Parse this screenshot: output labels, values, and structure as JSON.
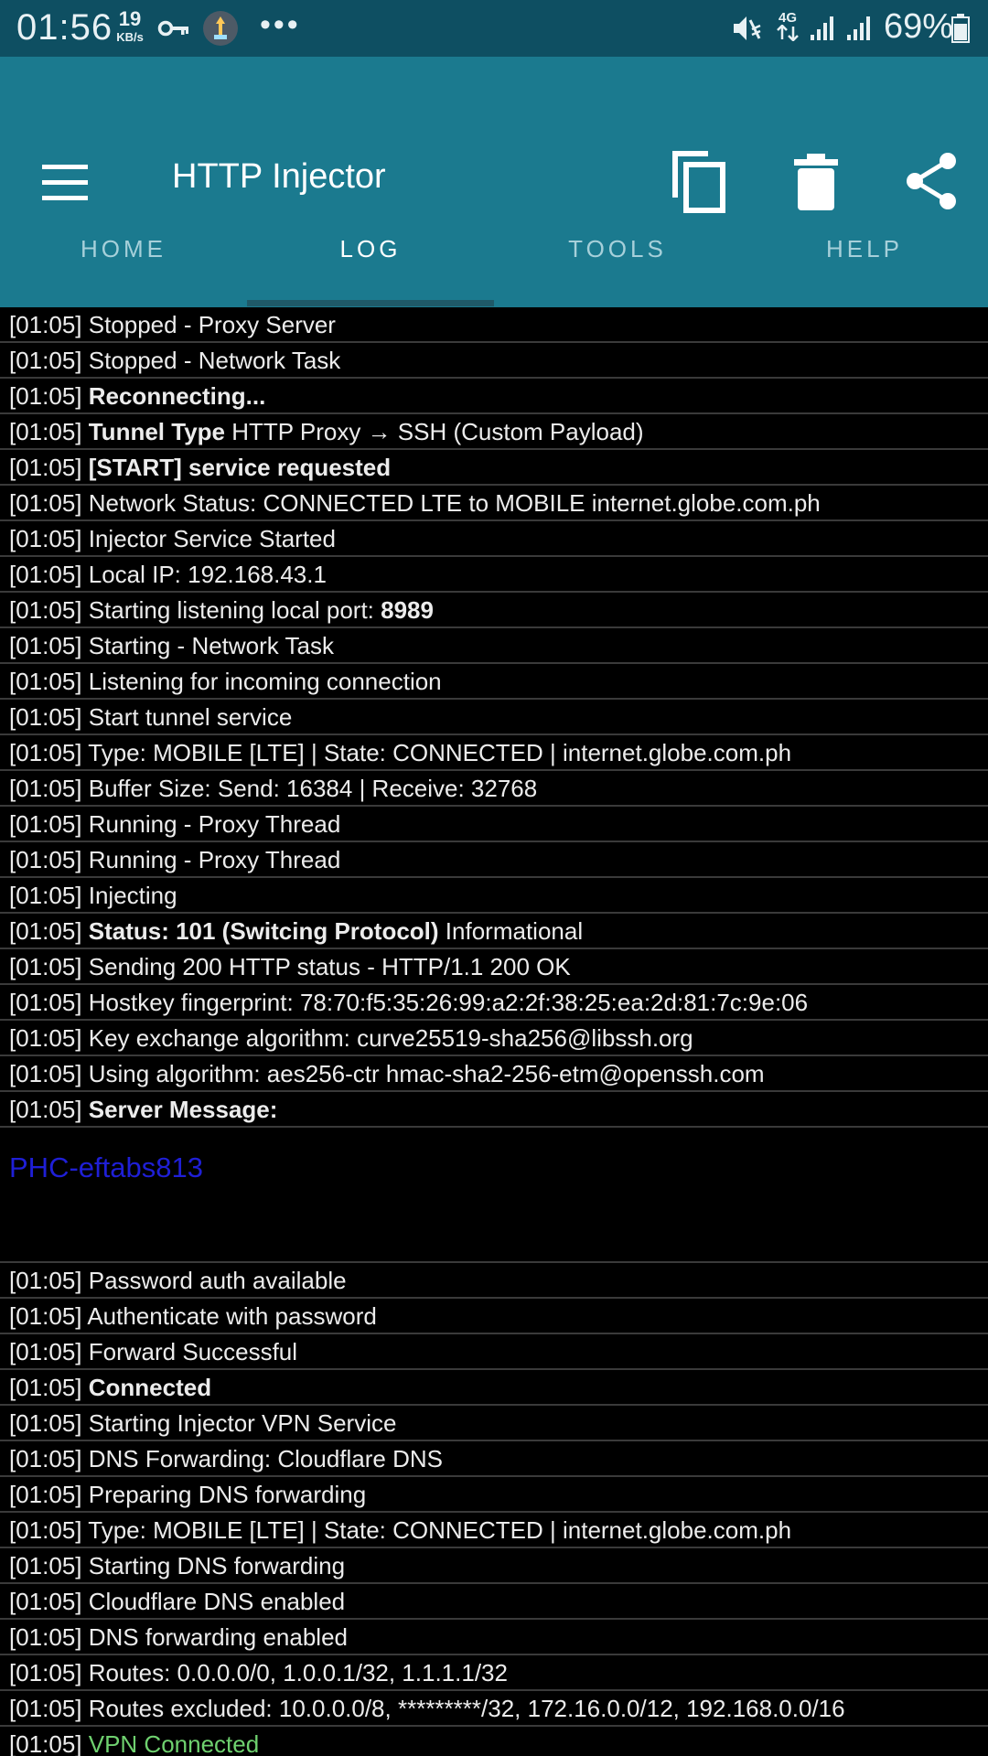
{
  "status_bar": {
    "time": "01:56",
    "net_speed_value": "19",
    "net_speed_unit": "KB/s",
    "icons": [
      "key-icon",
      "vpn-app-icon",
      "more-dots-icon",
      "mute-icon",
      "4g-data-icon",
      "signal-icon",
      "signal-icon",
      "battery-icon"
    ],
    "more": "•••",
    "network": "4G",
    "battery": "69%"
  },
  "app_bar": {
    "title": "HTTP Injector",
    "icons": [
      "menu-icon",
      "copy-icon",
      "trash-icon",
      "share-icon"
    ]
  },
  "tabs": [
    {
      "label": "HOME"
    },
    {
      "label": "LOG",
      "active": true
    },
    {
      "label": "TOOLS"
    },
    {
      "label": "HELP"
    }
  ],
  "log": {
    "time": "[01:05]",
    "entries": [
      {
        "text": "Stopped - Proxy Server"
      },
      {
        "text": "Stopped - Network Task"
      },
      {
        "bold": "Reconnecting..."
      },
      {
        "bold": "Tunnel Type",
        "text": "HTTP Proxy → SSH (Custom Payload)"
      },
      {
        "bold": "[START] service requested"
      },
      {
        "text": "Network Status: CONNECTED LTE to MOBILE internet.globe.com.ph"
      },
      {
        "text": "Injector Service Started"
      },
      {
        "text": "Local IP: 192.168.43.1"
      },
      {
        "text": "Starting listening local port:",
        "bold_after": "8989"
      },
      {
        "text": "Starting - Network Task"
      },
      {
        "text": "Listening for incoming connection"
      },
      {
        "text": "Start tunnel service"
      },
      {
        "text": "Type: MOBILE [LTE] | State: CONNECTED | internet.globe.com.ph"
      },
      {
        "text": "Buffer Size: Send: 16384 | Receive: 32768"
      },
      {
        "text": "Running - Proxy Thread"
      },
      {
        "text": "Running - Proxy Thread"
      },
      {
        "text": "Injecting"
      },
      {
        "bold": "Status: 101 (Switcing Protocol)",
        "text": "Informational"
      },
      {
        "text": "Sending 200 HTTP status - HTTP/1.1 200 OK"
      },
      {
        "text": "Hostkey fingerprint: 78:70:f5:35:26:99:a2:2f:38:25:ea:2d:81:7c:9e:06"
      },
      {
        "text": "Key exchange algorithm: curve25519-sha256@libssh.org"
      },
      {
        "text": "Using algorithm: aes256-ctr hmac-sha2-256-etm@openssh.com"
      },
      {
        "bold": "Server Message:"
      },
      {
        "server_message": "PHC-eftabs813"
      },
      {
        "text": "Password auth available"
      },
      {
        "text": "Authenticate with password"
      },
      {
        "text": "Forward Successful"
      },
      {
        "bold": "Connected"
      },
      {
        "text": "Starting Injector VPN Service"
      },
      {
        "text": "DNS Forwarding: Cloudflare DNS"
      },
      {
        "text": "Preparing DNS forwarding"
      },
      {
        "text": "Type: MOBILE [LTE] | State: CONNECTED | internet.globe.com.ph"
      },
      {
        "text": "Starting DNS forwarding"
      },
      {
        "text": "Cloudflare DNS enabled"
      },
      {
        "text": "DNS forwarding enabled"
      },
      {
        "text": "Routes: 0.0.0.0/0, 1.0.0.1/32, 1.1.1.1/32"
      },
      {
        "text": "Routes excluded: 10.0.0.0/8, *********/32, 172.16.0.0/12, 192.168.0.0/16"
      },
      {
        "green": "VPN Connected"
      }
    ]
  },
  "colors": {
    "status_bar": "#0e4f62",
    "app_bar": "#1b7a8f",
    "server_message": "#1f1fd6",
    "vpn_connected": "#6fd16f"
  }
}
